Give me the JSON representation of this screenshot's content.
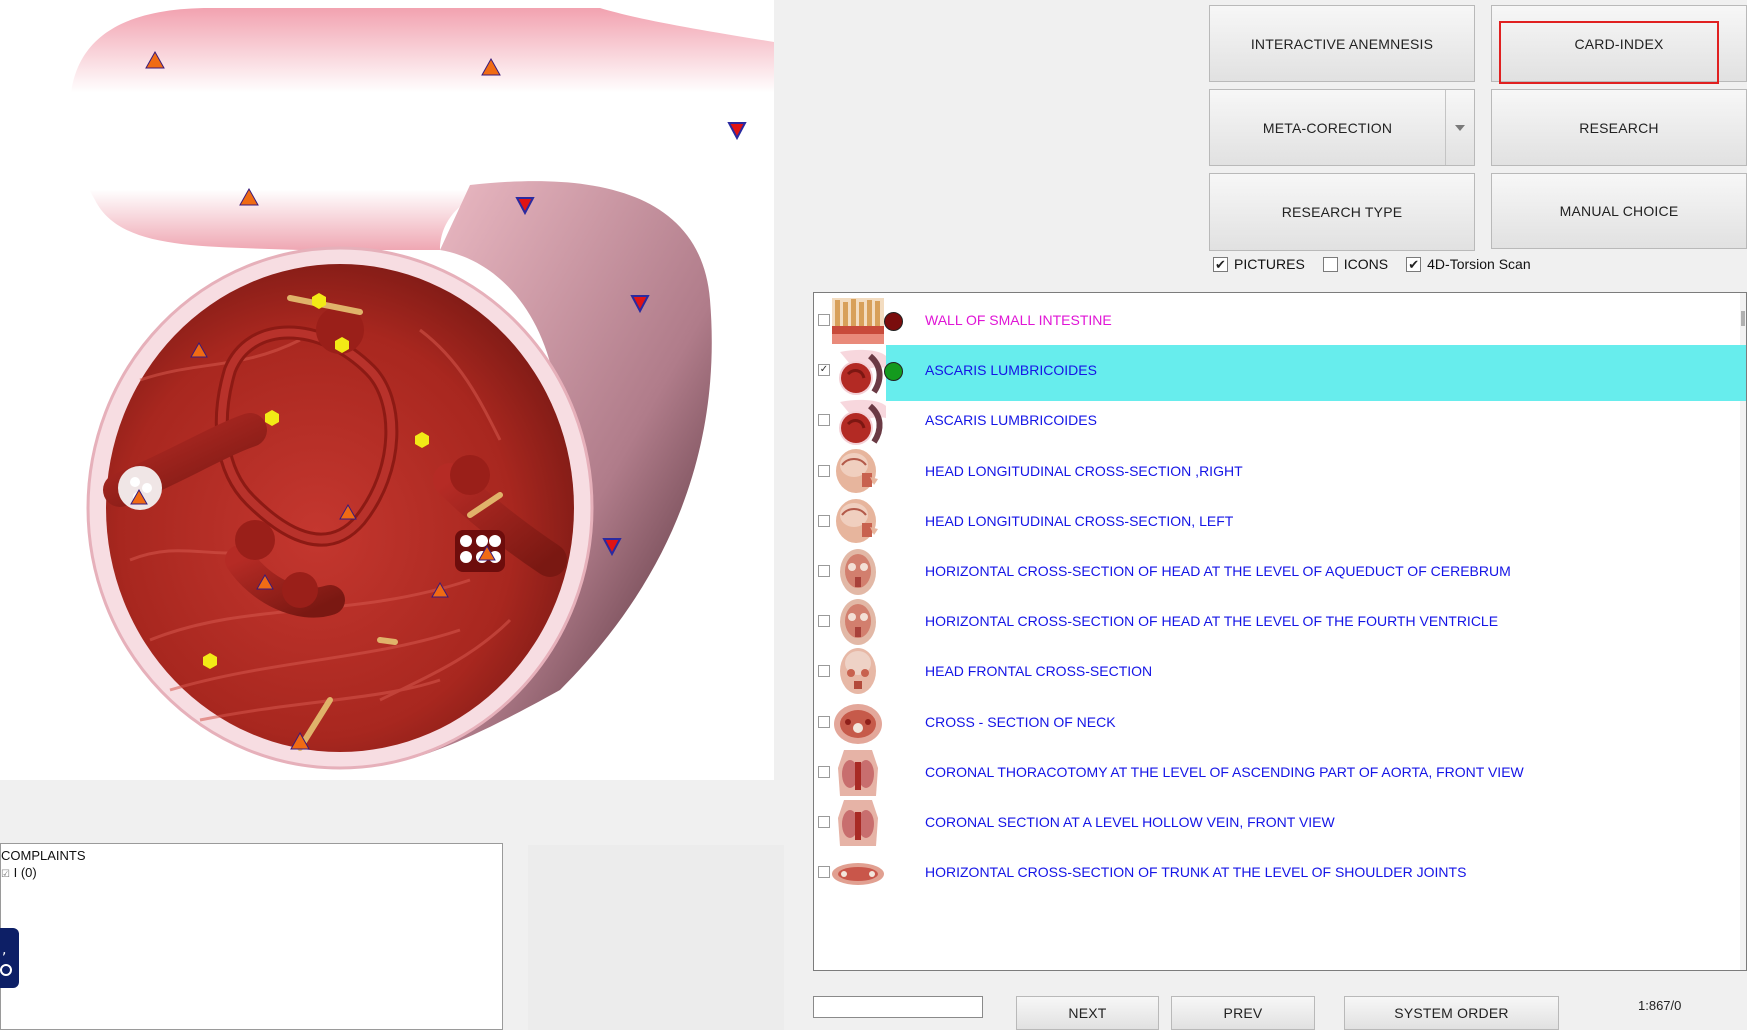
{
  "toolbar": {
    "interactive_anemnesis": "INTERACTIVE ANEMNESIS",
    "card_index": "CARD-INDEX",
    "meta_corection": "META-CORECTION",
    "research": "RESEARCH",
    "research_type": "RESEARCH TYPE",
    "manual_choice": "MANUAL CHOICE"
  },
  "options": {
    "pictures": {
      "label": "PICTURES",
      "checked": true
    },
    "icons": {
      "label": "ICONS",
      "checked": false
    },
    "torsion": {
      "label": "4D-Torsion Scan",
      "checked": true
    }
  },
  "list": {
    "items": [
      {
        "label": "WALL OF SMALL  INTESTINE",
        "checked": false,
        "selected": false,
        "color": "#e015d6",
        "dot": "#7a0d0d",
        "thumb": "intestine-wall"
      },
      {
        "label": "ASCARIS  LUMBRICOIDES",
        "checked": true,
        "selected": true,
        "color": "#1414e6",
        "dot": "#149a1e",
        "thumb": "ascaris"
      },
      {
        "label": "ASCARIS  LUMBRICOIDES",
        "checked": false,
        "selected": false,
        "color": "#1414e6",
        "dot": "",
        "thumb": "ascaris"
      },
      {
        "label": "HEAD LONGITUDINAL CROSS-SECTION ,RIGHT",
        "checked": false,
        "selected": false,
        "color": "#1414e6",
        "dot": "",
        "thumb": "head-side"
      },
      {
        "label": "HEAD LONGITUDINAL CROSS-SECTION, LEFT",
        "checked": false,
        "selected": false,
        "color": "#1414e6",
        "dot": "",
        "thumb": "head-side"
      },
      {
        "label": "HORIZONTAL CROSS-SECTION OF HEAD AT THE LEVEL OF AQUEDUCT OF CEREBRUM",
        "checked": false,
        "selected": false,
        "color": "#1414e6",
        "dot": "",
        "thumb": "head-top"
      },
      {
        "label": "HORIZONTAL CROSS-SECTION OF HEAD AT THE LEVEL OF THE FOURTH VENTRICLE",
        "checked": false,
        "selected": false,
        "color": "#1414e6",
        "dot": "",
        "thumb": "head-top"
      },
      {
        "label": "HEAD FRONTAL CROSS-SECTION",
        "checked": false,
        "selected": false,
        "color": "#1414e6",
        "dot": "",
        "thumb": "head-front"
      },
      {
        "label": "CROSS - SECTION  OF   NECK",
        "checked": false,
        "selected": false,
        "color": "#1414e6",
        "dot": "",
        "thumb": "neck"
      },
      {
        "label": "CORONAL THORACOTOMY AT THE LEVEL OF ASCENDING PART OF AORTA, FRONT VIEW",
        "checked": false,
        "selected": false,
        "color": "#1414e6",
        "dot": "",
        "thumb": "torso"
      },
      {
        "label": "CORONAL SECTION AT A LEVEL HOLLOW VEIN, FRONT VIEW",
        "checked": false,
        "selected": false,
        "color": "#1414e6",
        "dot": "",
        "thumb": "torso"
      },
      {
        "label": "HORIZONTAL CROSS-SECTION OF TRUNK AT THE LEVEL OF SHOULDER JOINTS",
        "checked": false,
        "selected": false,
        "color": "#1414e6",
        "dot": "",
        "thumb": "trunk"
      }
    ]
  },
  "complaints": {
    "title": "COMPLAINTS",
    "item": "I (0)"
  },
  "bottom": {
    "search_value": "",
    "next": "NEXT",
    "prev": "PREV",
    "system_order": "SYSTEM ORDER",
    "counter": "1:867/0"
  },
  "colors": {
    "accent_highlight": "#e02020",
    "selected_row": "#67eded",
    "link_text": "#1414e6",
    "first_item_text": "#e015d6"
  },
  "icons": {
    "marker_up": "orange-triangle-marker",
    "marker_down": "red-inverted-triangle-marker",
    "marker_hex": "yellow-hexagon-marker",
    "widget": "gear-icon"
  }
}
